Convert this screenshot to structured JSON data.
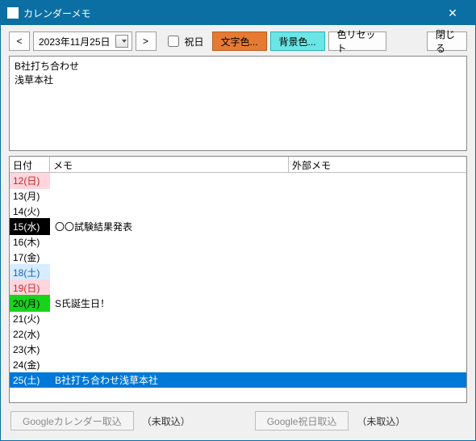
{
  "window": {
    "title": "カレンダーメモ",
    "close": "✕"
  },
  "toolbar": {
    "prev": "<",
    "next": ">",
    "date": "2023年11月25日",
    "holiday": "祝日",
    "textcolor": "文字色...",
    "bgcolor": "背景色...",
    "resetcolor": "色リセット",
    "close_btn": "閉じる"
  },
  "memo": "B社打ち合わせ\n浅草本社",
  "grid": {
    "headers": {
      "date": "日付",
      "memo": "メモ",
      "ext": "外部メモ"
    },
    "rows": [
      {
        "date": "12(日)",
        "memo": "",
        "ext": "",
        "date_bg": "#ffd6de",
        "date_fg": "#c6261f"
      },
      {
        "date": "13(月)",
        "memo": "",
        "ext": ""
      },
      {
        "date": "14(火)",
        "memo": "",
        "ext": ""
      },
      {
        "date": "15(水)",
        "memo": "〇〇試験結果発表",
        "ext": "",
        "date_bg": "#000000",
        "date_fg": "#ffffff"
      },
      {
        "date": "16(木)",
        "memo": "",
        "ext": ""
      },
      {
        "date": "17(金)",
        "memo": "",
        "ext": ""
      },
      {
        "date": "18(土)",
        "memo": "",
        "ext": "",
        "date_bg": "#d6ecff",
        "date_fg": "#1560c0"
      },
      {
        "date": "19(日)",
        "memo": "",
        "ext": "",
        "date_bg": "#ffd6de",
        "date_fg": "#c6261f"
      },
      {
        "date": "20(月)",
        "memo": "S氏誕生日！",
        "ext": "",
        "date_bg": "#17d41a",
        "date_fg": "#000000"
      },
      {
        "date": "21(火)",
        "memo": "",
        "ext": ""
      },
      {
        "date": "22(水)",
        "memo": "",
        "ext": ""
      },
      {
        "date": "23(木)",
        "memo": "",
        "ext": ""
      },
      {
        "date": "24(金)",
        "memo": "",
        "ext": ""
      },
      {
        "date": "25(土)",
        "memo": "B社打ち合わせ浅草本社",
        "ext": "",
        "selected": true
      }
    ]
  },
  "footer": {
    "gcal_import": "Googleカレンダー取込",
    "gcal_status": "（未取込）",
    "ghol_import": "Google祝日取込",
    "ghol_status": "（未取込）"
  }
}
